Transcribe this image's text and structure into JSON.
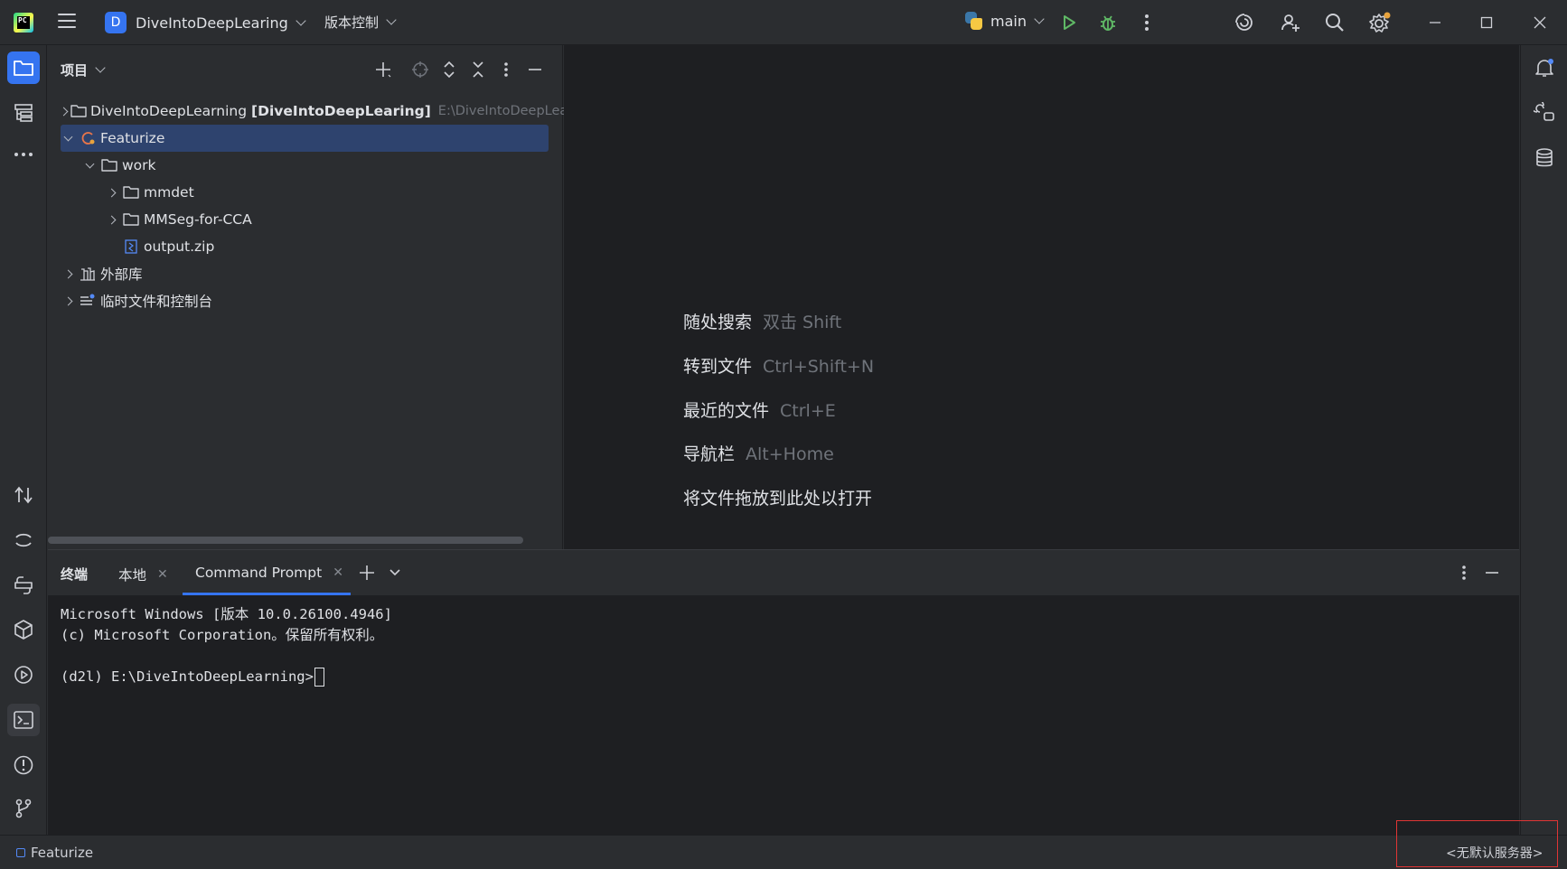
{
  "titlebar": {
    "logo_text": "PC",
    "project_badge": "D",
    "project_name": "DiveIntoDeepLearing",
    "vcs_label": "版本控制",
    "run_config": "main"
  },
  "project_panel": {
    "title": "项目",
    "tree": [
      {
        "label": "DiveIntoDeepLearning",
        "bold": "[DiveIntoDeepLearing]",
        "path": "E:\\DiveIntoDeepLearn"
      },
      {
        "label": "Featurize"
      },
      {
        "label": "work"
      },
      {
        "label": "mmdet"
      },
      {
        "label": "MMSeg-for-CCA"
      },
      {
        "label": "output.zip"
      },
      {
        "label": "外部库"
      },
      {
        "label": "临时文件和控制台"
      }
    ]
  },
  "editor_hints": [
    {
      "label": "随处搜索",
      "key": "双击 Shift"
    },
    {
      "label": "转到文件",
      "key": "Ctrl+Shift+N"
    },
    {
      "label": "最近的文件",
      "key": "Ctrl+E"
    },
    {
      "label": "导航栏",
      "key": "Alt+Home"
    },
    {
      "label": "将文件拖放到此处以打开",
      "key": ""
    }
  ],
  "terminal": {
    "title": "终端",
    "tabs": [
      "本地",
      "Command Prompt"
    ],
    "lines": [
      "Microsoft Windows [版本 10.0.26100.4946]",
      "(c) Microsoft Corporation。保留所有权利。",
      "",
      "(d2l) E:\\DiveIntoDeepLearning>"
    ]
  },
  "statusbar": {
    "crumb": "Featurize",
    "server": "<无默认服务器>"
  },
  "colors": {
    "accent": "#3574f0",
    "selection": "#2e436e",
    "run_green": "#5fb865",
    "highlight_box": "#e03535"
  }
}
